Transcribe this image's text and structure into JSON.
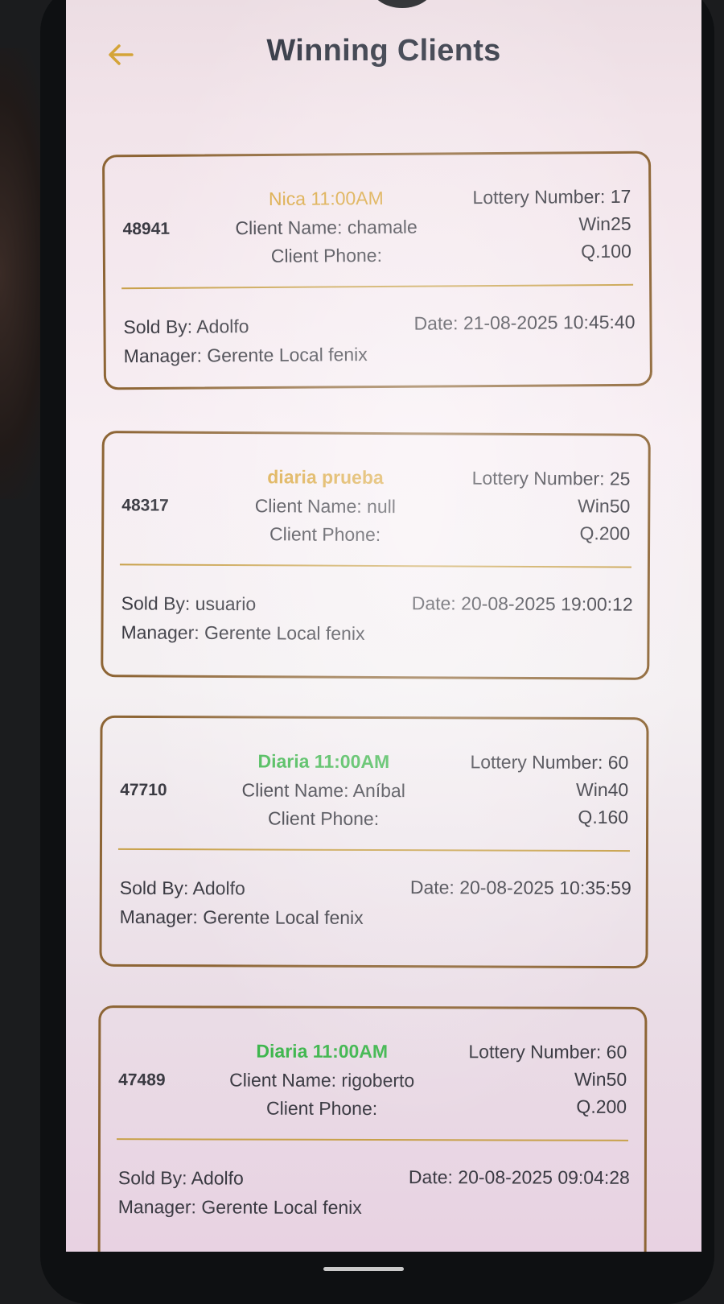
{
  "header": {
    "title": "Winning Clients",
    "back_icon": "arrow-left-icon"
  },
  "colors": {
    "accent": "#d9a53c",
    "green": "#3fb64e",
    "border": "#8d6535"
  },
  "cards": [
    {
      "id": "48941",
      "lottery": "Nica 11:00AM",
      "lottery_color": "orange",
      "client_name": "Client Name: chamale",
      "client_phone": "Client Phone:",
      "lottery_number": "Lottery Number: 17",
      "win": "Win25",
      "amount": "Q.100",
      "sold_by": "Sold By: Adolfo",
      "date": "Date: 21-08-2025 10:45:40",
      "manager": "Manager: Gerente Local fenix"
    },
    {
      "id": "48317",
      "lottery": "diaria prueba",
      "lottery_color": "orange",
      "client_name": "Client Name: null",
      "client_phone": "Client Phone:",
      "lottery_number": "Lottery Number: 25",
      "win": "Win50",
      "amount": "Q.200",
      "sold_by": "Sold By: usuario",
      "date": "Date: 20-08-2025 19:00:12",
      "manager": "Manager: Gerente Local fenix"
    },
    {
      "id": "47710",
      "lottery": "Diaria 11:00AM",
      "lottery_color": "green",
      "client_name": "Client Name: Aníbal",
      "client_phone": "Client Phone:",
      "lottery_number": "Lottery Number: 60",
      "win": "Win40",
      "amount": "Q.160",
      "sold_by": "Sold By: Adolfo",
      "date": "Date: 20-08-2025 10:35:59",
      "manager": "Manager: Gerente Local fenix"
    },
    {
      "id": "47489",
      "lottery": "Diaria 11:00AM",
      "lottery_color": "green",
      "client_name": "Client Name: rigoberto",
      "client_phone": "Client Phone:",
      "lottery_number": "Lottery Number: 60",
      "win": "Win50",
      "amount": "Q.200",
      "sold_by": "Sold By: Adolfo",
      "date": "Date: 20-08-2025 09:04:28",
      "manager": "Manager: Gerente Local fenix"
    }
  ]
}
